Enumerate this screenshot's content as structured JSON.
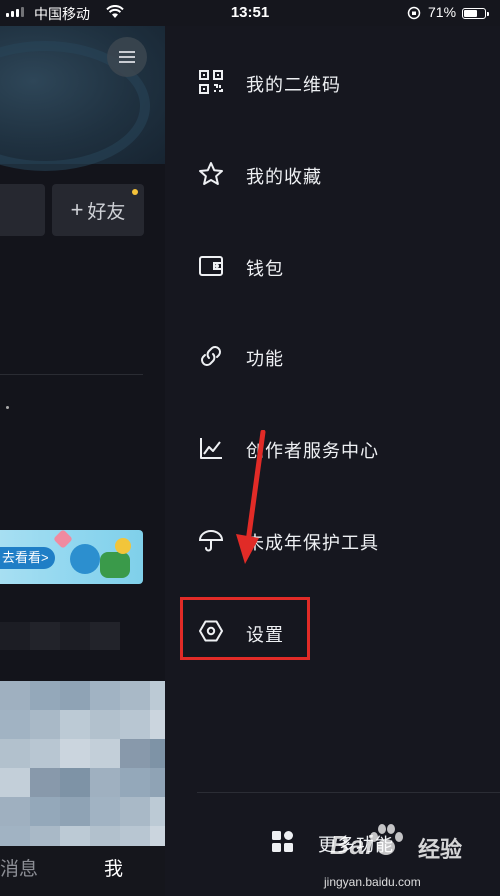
{
  "status_bar": {
    "carrier": "中国移动",
    "time": "13:51",
    "battery_percent": "71%",
    "battery_level": 0.71
  },
  "background_page": {
    "add_friend_label": "好友",
    "add_friend_plus": "+",
    "promo_button_label": "去看看>",
    "bottom_nav": {
      "messages": "消息",
      "me": "我"
    }
  },
  "drawer": {
    "items": [
      {
        "icon": "qrcode-icon",
        "label": "我的二维码"
      },
      {
        "icon": "star-icon",
        "label": "我的收藏"
      },
      {
        "icon": "wallet-icon",
        "label": "钱包"
      },
      {
        "icon": "link-icon",
        "label": "功能"
      },
      {
        "icon": "chart-icon",
        "label": "创作者服务中心"
      },
      {
        "icon": "umbrella-icon",
        "label": "未成年保护工具"
      },
      {
        "icon": "settings-hexagon-icon",
        "label": "设置"
      }
    ],
    "more_label": "更多功能",
    "more_icon": "grid-icon"
  },
  "annotation": {
    "highlight_color": "#e12b27",
    "highlighted_item": "设置"
  },
  "watermark": {
    "logo": "Bai",
    "logo_suffix": "经验",
    "url": "jingyan.baidu.com"
  },
  "colors": {
    "drawer_bg": "#16171f",
    "text": "#eef0f3",
    "accent_dot": "#f4c23a"
  }
}
